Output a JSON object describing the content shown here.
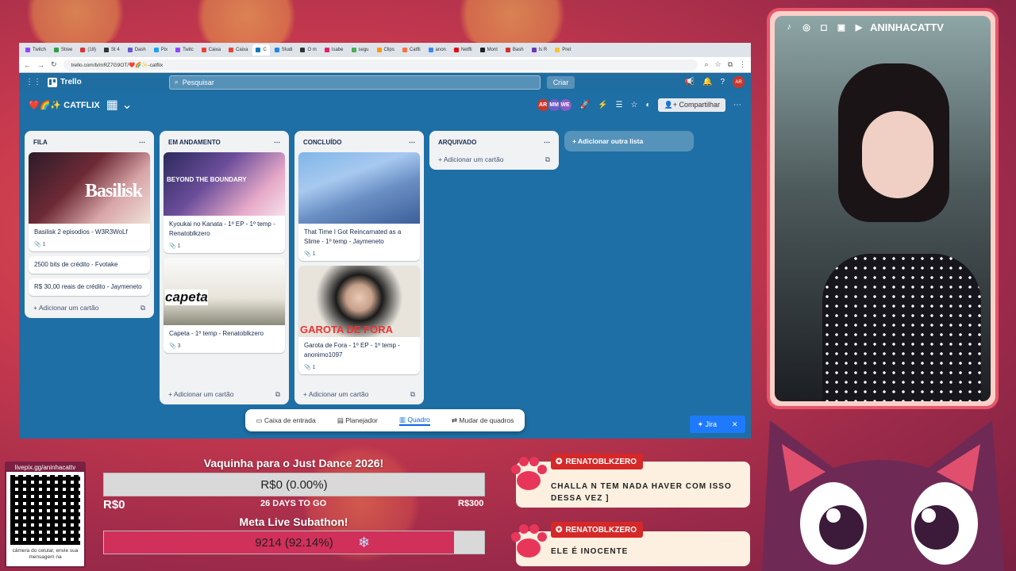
{
  "browser": {
    "tabs": [
      "Twitch",
      "Stree",
      "(18)",
      "St 4",
      "Dash",
      "Pix",
      "Twitc",
      "Caixa",
      "Caixa",
      "C",
      "Studi",
      "O m",
      "Isabe",
      "segu",
      "Clips",
      "Catfli",
      "anon",
      "Netfli",
      "Mont",
      "Bash",
      "Is R",
      "Pret"
    ],
    "url": "trello.com/b/mRZ7G9OT/❤️🌈✨-catflix"
  },
  "trello": {
    "app_name": "Trello",
    "search_placeholder": "Pesquisar",
    "create_label": "Criar",
    "board_title": "❤️🌈✨ CATFLIX",
    "members": [
      "AR",
      "MM",
      "WE"
    ],
    "share_label": "Compartilhar",
    "lists": [
      {
        "title": "FILA",
        "cards": [
          {
            "title": "Basilisk 2 episodios - W3R3WoLf",
            "attachments": "1",
            "cover": "Basilisk"
          },
          {
            "title": "2500 bits de crédito - Fvotake"
          },
          {
            "title": "R$ 30,00 reais de crédito - Jaymeneto"
          }
        ],
        "add_card": "Adicionar um cartão"
      },
      {
        "title": "EM ANDAMENTO",
        "cards": [
          {
            "title": "Kyoukai no Kanata - 1º EP - 1º temp - Renatoblkzero",
            "attachments": "1",
            "cover": "BEYOND THE BOUNDARY"
          },
          {
            "title": "Capeta - 1º temp - Renatoblkzero",
            "attachments": "3",
            "cover": "capeta"
          }
        ],
        "add_card": "Adicionar um cartão"
      },
      {
        "title": "CONCLUÍDO",
        "cards": [
          {
            "title": "That Time I Got Reincarnated as a Slime - 1º temp - Jaymeneto",
            "attachments": "1"
          },
          {
            "title": "Garota de Fora - 1º EP - 1º temp -anonimo1097",
            "attachments": "1",
            "cover": "GAROTA DE FORA"
          }
        ],
        "add_card": "Adicionar um cartão"
      },
      {
        "title": "ARQUIVADO",
        "cards": [],
        "add_card": "Adicionar um cartão"
      }
    ],
    "add_list": "Adicionar outra lista",
    "bottom_nav": [
      "Caixa de entrada",
      "Planejador",
      "Quadro",
      "Mudar de quadros"
    ],
    "jira": "Jira"
  },
  "stream": {
    "channel": "ANINHACATTV",
    "qr_label": "livepix.gg/aninhacattv",
    "qr_foot": "câmera do celular, envie sua mensagem na",
    "goal1": {
      "title": "Vaquinha para o Just Dance 2026!",
      "text": "R$0 (0.00%)",
      "progress": 0.0,
      "min": "R$0",
      "days": "26 DAYS TO GO",
      "max": "R$300"
    },
    "goal2": {
      "title": "Meta Live Subathon!",
      "text": "9214 (92.14%)",
      "progress": 92.14
    }
  },
  "chat": [
    {
      "user": "RENATOBLKZERO",
      "message": "CHALLA N TEM NADA HAVER COM ISSO DESSA VEZ ]"
    },
    {
      "user": "RENATOBLKZERO",
      "message": "ELE É INOCENTE"
    }
  ]
}
